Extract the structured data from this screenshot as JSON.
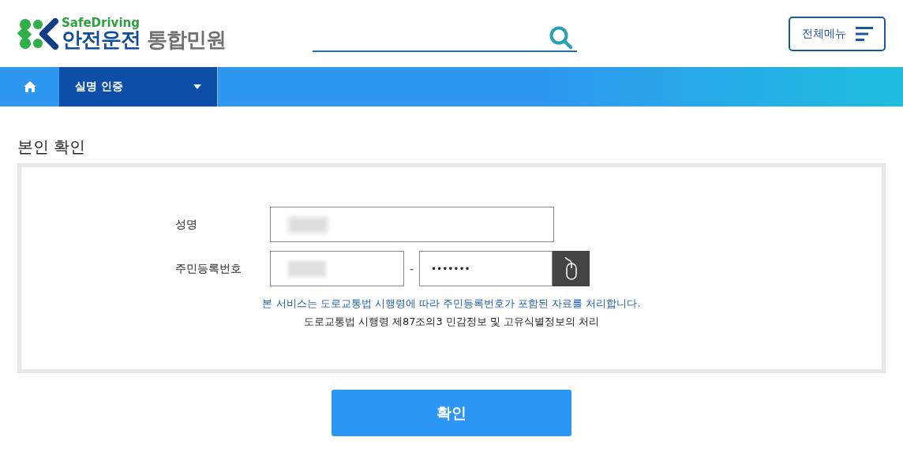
{
  "logo": {
    "tagline": "SafeDriving",
    "name": "안전운전",
    "suffix": "통합민원"
  },
  "header": {
    "menu_button": "전체메뉴"
  },
  "nav": {
    "current": "실명 인증"
  },
  "page_title": "본인 확인",
  "form": {
    "name_label": "성명",
    "id_label": "주민등록번호",
    "separator": "-",
    "id_back_value": "•••••••",
    "notice": "본 서비스는 도로교통법 시행령에 따라 주민등록번호가 포함된 자료를 처리합니다.",
    "legal_basis": "도로교통법 시행령 제87조의3 민감정보 및 고유식별정보의 처리"
  },
  "submit": "확인"
}
